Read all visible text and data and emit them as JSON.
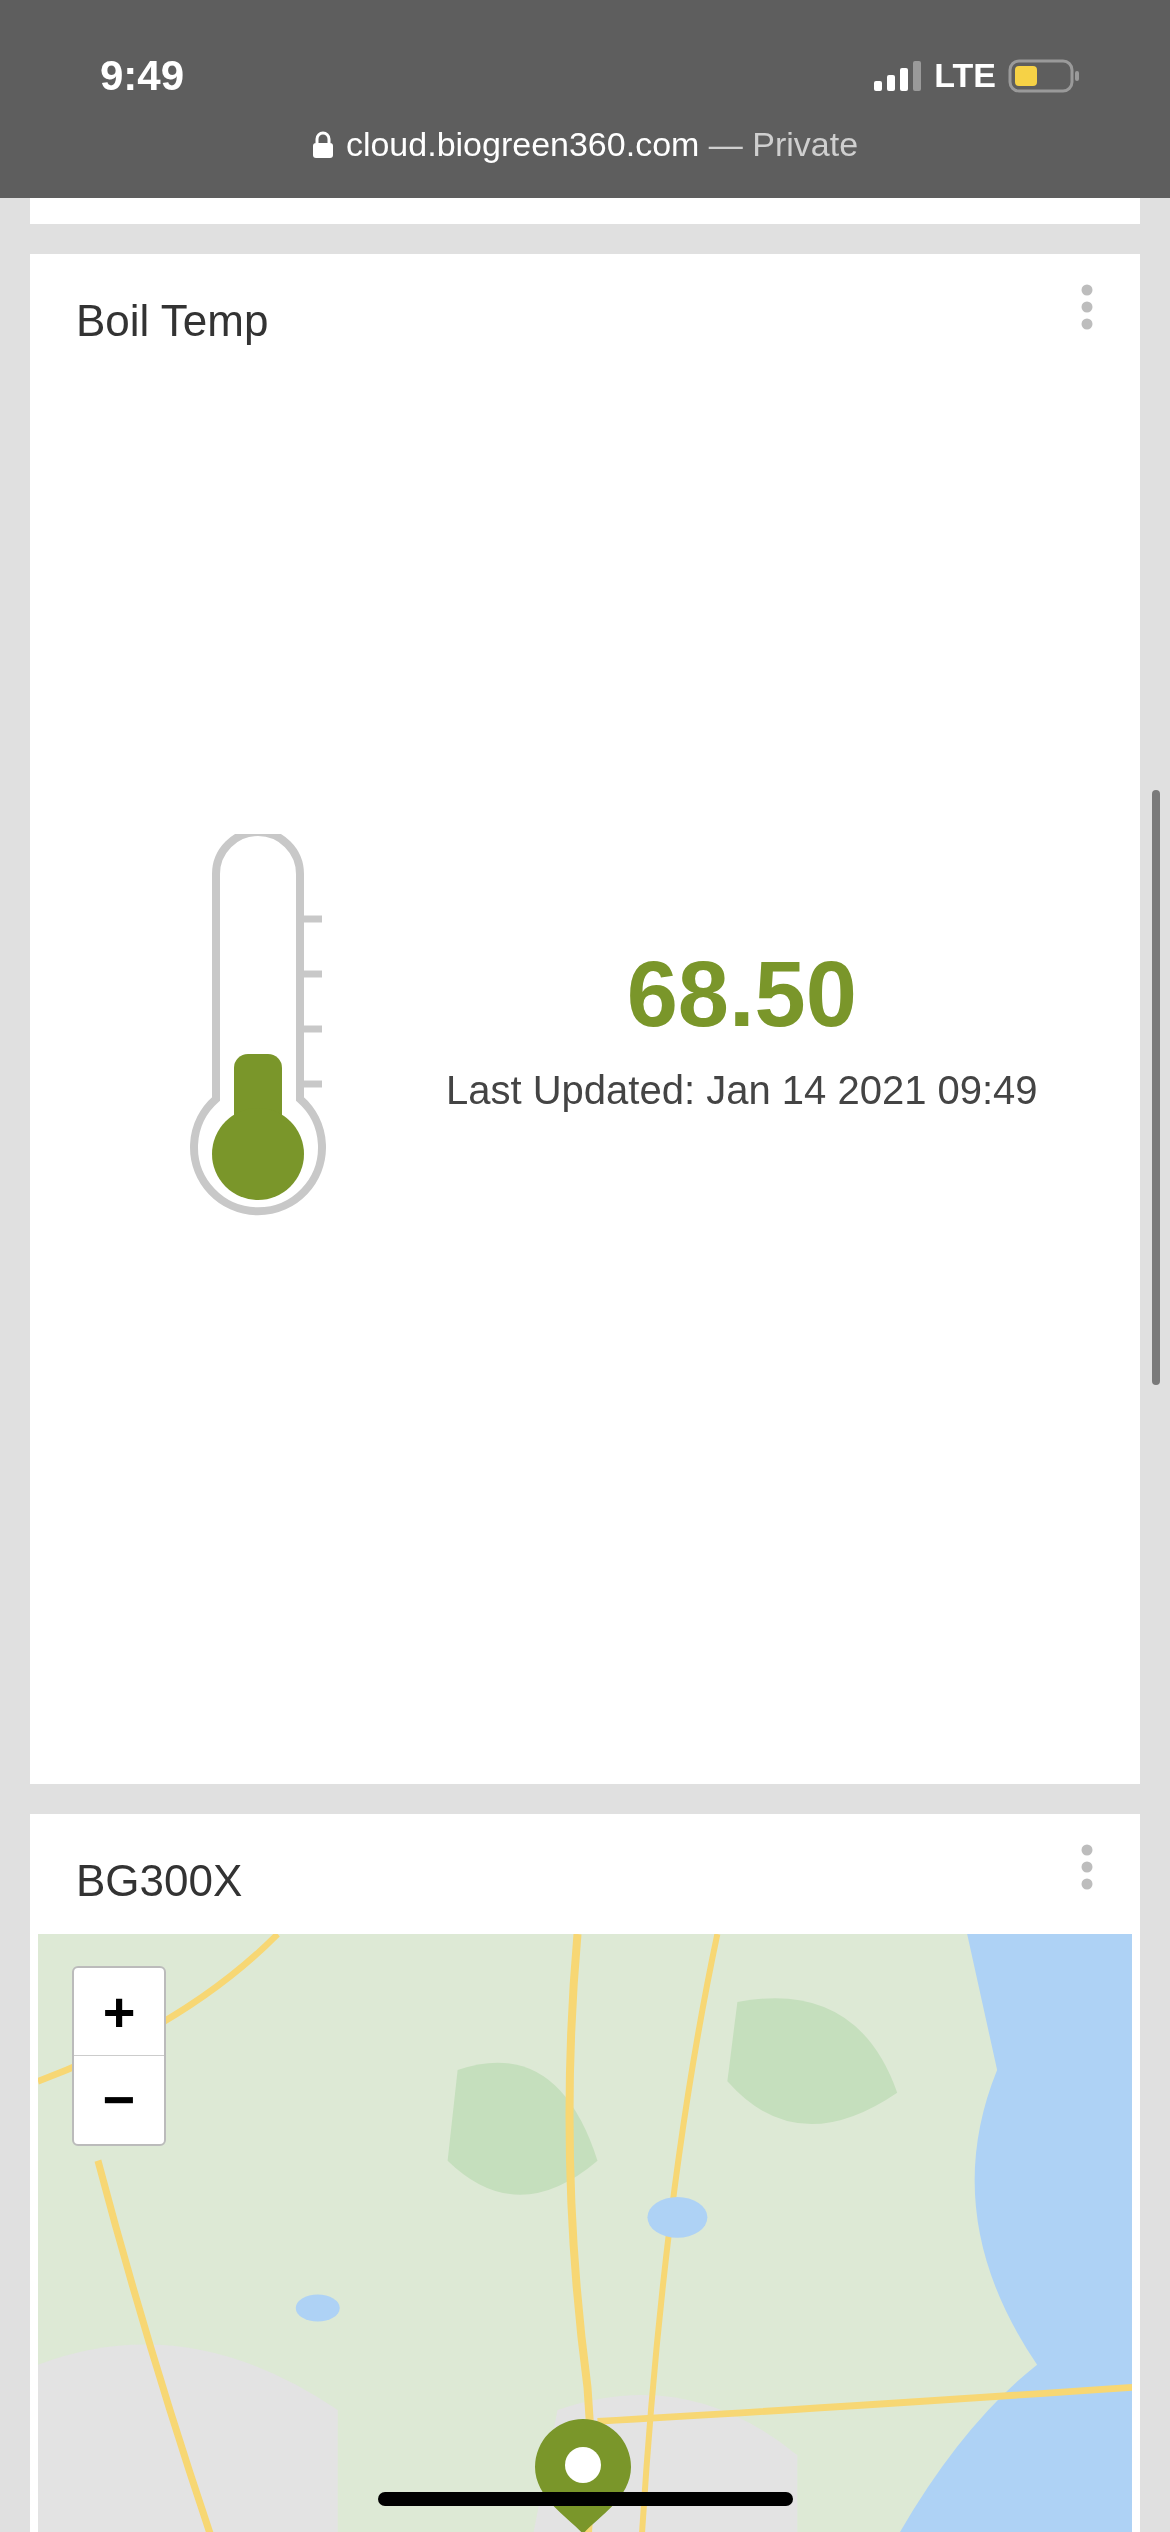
{
  "status_bar": {
    "time": "9:49",
    "network": "LTE"
  },
  "address_bar": {
    "url": "cloud.biogreen360.com",
    "suffix": "— Private"
  },
  "cards": [
    {
      "kind": "gauge",
      "title": "Boil Temp",
      "value": "68.50",
      "updated": "Last Updated: Jan 14 2021 09:49",
      "level": 0.4
    },
    {
      "kind": "map",
      "title": "BG300X",
      "zoom_in": "+",
      "zoom_out": "−"
    }
  ]
}
